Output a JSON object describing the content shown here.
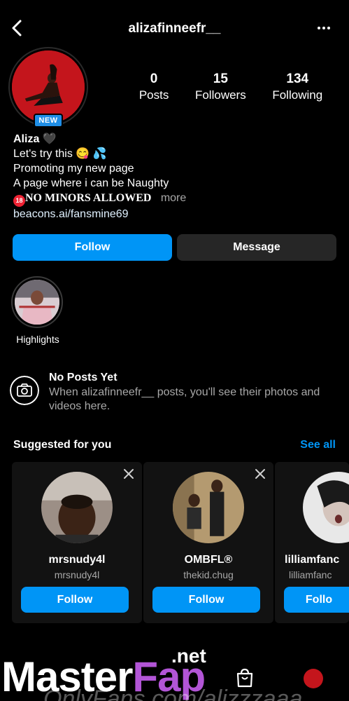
{
  "header": {
    "username": "alizafinneefr__"
  },
  "profile": {
    "badge": "NEW",
    "stats": [
      {
        "value": "0",
        "label": "Posts"
      },
      {
        "value": "15",
        "label": "Followers"
      },
      {
        "value": "134",
        "label": "Following"
      }
    ],
    "name": "Aliza",
    "name_emoji": "🖤",
    "bio_line1": "Let's try this 😋 💦",
    "bio_line2": "Promoting my new page",
    "bio_line3": "A page where i can be Naughty",
    "bio_line4_badge": "18",
    "bio_line4": "NO MINORS ALLOWED",
    "bio_more": "more",
    "link": "beacons.ai/fansmine69"
  },
  "actions": {
    "follow": "Follow",
    "message": "Message"
  },
  "highlights": [
    {
      "label": "Highlights"
    }
  ],
  "no_posts": {
    "title": "No Posts Yet",
    "text": "When alizafinneefr__ posts, you'll see their photos and videos here."
  },
  "suggested": {
    "heading": "Suggested for you",
    "see_all": "See all",
    "cards": [
      {
        "name": "mrsnudy4l",
        "handle": "mrsnudy4l",
        "button": "Follow"
      },
      {
        "name": "OMBFL®",
        "handle": "thekid.chug",
        "button": "Follow"
      },
      {
        "name": "lilliamfanc",
        "handle": "lilliamfanc",
        "button": "Follo"
      }
    ]
  },
  "watermark": {
    "master": "Master",
    "fap": "Fap",
    "net": ".net",
    "sub": "OnlyFans.com/alizzzaaa"
  },
  "colors": {
    "accent": "#0095f6",
    "badge": "#1f8ee6",
    "background": "#000000",
    "card": "#121212"
  }
}
